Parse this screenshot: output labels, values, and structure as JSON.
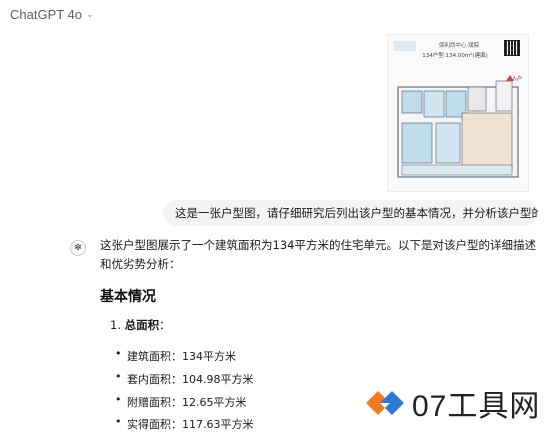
{
  "header": {
    "model": "ChatGPT 4o",
    "chevron_icon": "chevron-down-icon"
  },
  "attachment": {
    "title": "保利西中心·璞院",
    "subtitle": "134户型:134.00m²(建面)",
    "entry_label": "入户"
  },
  "user_message": "这是一张户型图，请仔细研究后列出该户型的基本情况，并分析该户型的优劣势。",
  "assistant": {
    "intro": "这张户型图展示了一个建筑面积为134平方米的住宅单元。以下是对该户型的详细描述和优劣势分析：",
    "section_title": "基本情况",
    "list_number": "1.",
    "list_label": "总面积",
    "list_colon": "：",
    "bullets": [
      "建筑面积：134平方米",
      "套内面积：104.98平方米",
      "附赠面积：12.65平方米",
      "实得面积：117.63平方米"
    ]
  },
  "watermark": {
    "text": "07工具网"
  },
  "colors": {
    "bubble_bg": "#f4f4f4",
    "watermark_orange": "#f07a24",
    "watermark_blue": "#2b7ad8"
  }
}
